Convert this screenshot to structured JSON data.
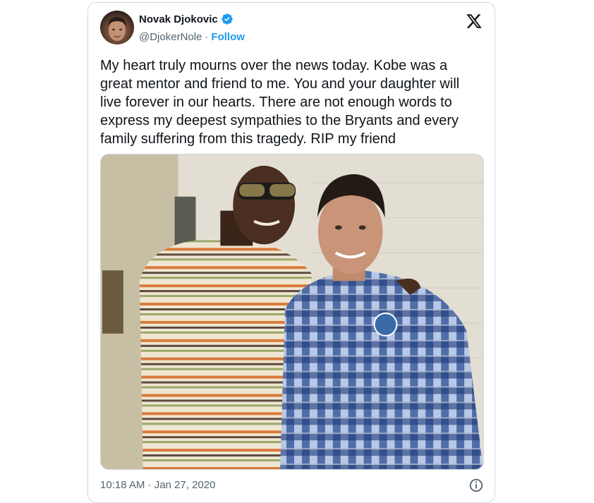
{
  "tweet": {
    "author": {
      "name": "Novak Djokovic",
      "handle": "@DjokerNole",
      "separator": "·",
      "follow_label": "Follow",
      "verified": true
    },
    "text": "My heart truly mourns over the news today. Kobe was a\ngreat mentor and friend to me. You and your daughter will\nlive forever in our hearts. There are not enough words to\nexpress my deepest sympathies to the Bryants and every\nfamily suffering from this tragedy. RIP my friend",
    "timestamp": "10:18 AM · Jan 27, 2020",
    "media": {
      "kind": "photo"
    }
  },
  "icons": {
    "platform_logo": "x-logo-icon",
    "verified_badge": "verified-badge-icon",
    "info": "info-icon"
  },
  "colors": {
    "accent": "#1d9bf0",
    "text_primary": "#0f1419",
    "text_secondary": "#536471",
    "border": "#cfd9de"
  }
}
